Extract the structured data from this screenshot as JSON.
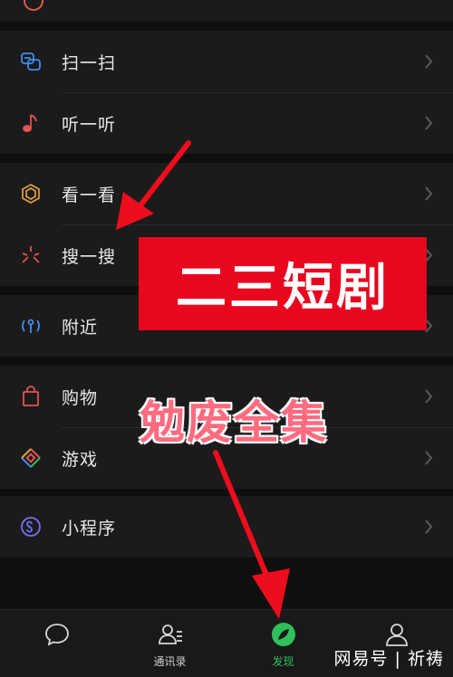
{
  "menu": {
    "items": [
      {
        "key": "scan",
        "label": "扫一扫",
        "icon": "scan-icon"
      },
      {
        "key": "shake",
        "label": "听一听",
        "icon": "music-note-icon"
      },
      {
        "key": "look",
        "label": "看一看",
        "icon": "look-icon"
      },
      {
        "key": "search",
        "label": "搜一搜",
        "icon": "search-sparkle-icon"
      },
      {
        "key": "nearby",
        "label": "附近",
        "icon": "nearby-icon"
      },
      {
        "key": "shopping",
        "label": "购物",
        "icon": "shopping-bag-icon"
      },
      {
        "key": "games",
        "label": "游戏",
        "icon": "games-icon"
      },
      {
        "key": "miniprogram",
        "label": "小程序",
        "icon": "miniprogram-icon"
      }
    ]
  },
  "bottom_nav": {
    "tabs": [
      {
        "key": "chats",
        "label": "",
        "icon": "chat-bubble-icon"
      },
      {
        "key": "contacts",
        "label": "通讯录",
        "icon": "contacts-icon"
      },
      {
        "key": "discover",
        "label": "发现",
        "icon": "compass-icon",
        "active": true
      },
      {
        "key": "me",
        "label": "",
        "icon": "person-icon"
      }
    ]
  },
  "overlay": {
    "red_banner": "二三短剧",
    "pink_text": "勉废全集"
  },
  "watermark": "网易号 | 祈祷",
  "colors": {
    "background": "#0f0f0f",
    "row_bg": "#1b1b1b",
    "accent_green": "#2ec05b",
    "banner_red": "#e8071f",
    "pink_text": "#ff6b7f"
  }
}
